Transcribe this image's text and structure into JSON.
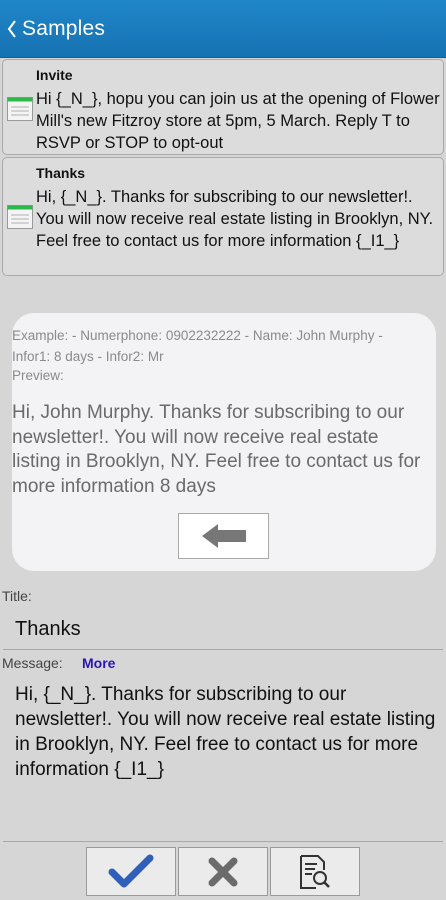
{
  "header": {
    "title": "Samples",
    "back_icon": "chevron-left-icon"
  },
  "samples": [
    {
      "title": "Invite",
      "text": "Hi {_N_}, hopu you can join us at the opening of Flower Mill's new Fitzroy store at 5pm, 5 March. Reply T to RSVP or STOP to opt-out"
    },
    {
      "title": "Thanks",
      "text": "Hi, {_N_}. Thanks for subscribing to our newsletter!. You will now receive real estate listing in Brooklyn, NY. Feel free to contact us for more information {_I1_}"
    }
  ],
  "preview": {
    "example": "Example: - Numerphone: 0902232222 - Name: John Murphy - Infor1: 8 days - Infor2: Mr",
    "label": "Preview:",
    "text": "Hi, John Murphy. Thanks for subscribing to our newsletter!. You will now receive real estate listing in Brooklyn, NY. Feel free to contact us for more information 8 days",
    "arrow_icon": "arrow-left-icon"
  },
  "form": {
    "title_label": "Title:",
    "title_value": "Thanks",
    "message_label": "Message:",
    "more_label": "More",
    "message_value": "Hi, {_N_}. Thanks for subscribing to our newsletter!. You will now receive real estate listing in Brooklyn, NY. Feel free to contact us for more information {_I1_}"
  },
  "toolbar": {
    "confirm_icon": "checkmark-icon",
    "cancel_icon": "close-icon",
    "preview_icon": "document-search-icon"
  },
  "colors": {
    "header": "#1a7cbf",
    "more_link": "#2a15b8",
    "check": "#2f5fb8",
    "icon_gray": "#6b6b6b"
  }
}
